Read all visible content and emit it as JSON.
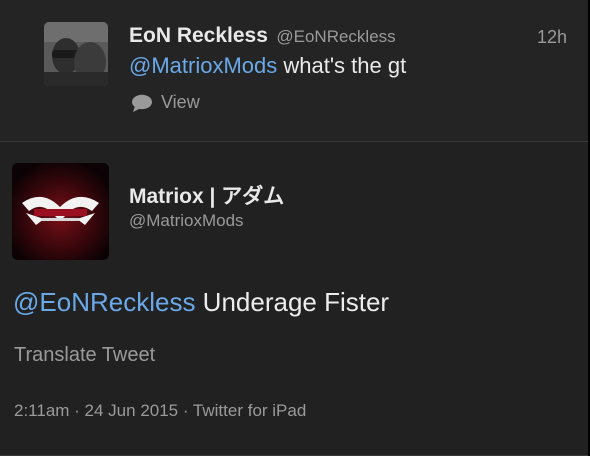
{
  "reply_tweet": {
    "author_name": "EoN Reckless",
    "author_handle": "@EoNReckless",
    "time": "12h",
    "mention": "@MatrioxMods",
    "text": " what's the gt",
    "view_label": "View",
    "avatar_icon": "user-avatar-photo"
  },
  "main_tweet": {
    "author_name": "Matriox | アダム",
    "author_handle": "@MatrioxMods",
    "mention": "@EoNReckless",
    "text": " Underage Fister",
    "translate_label": "Translate Tweet",
    "meta": "2:11am · 24 Jun 2015 · Twitter for iPad",
    "avatar_icon": "matriox-logo-avatar"
  },
  "colors": {
    "background": "#212121",
    "mention": "#6aa8e8",
    "muted": "#9a9a9a",
    "text": "#e9e9e9"
  }
}
